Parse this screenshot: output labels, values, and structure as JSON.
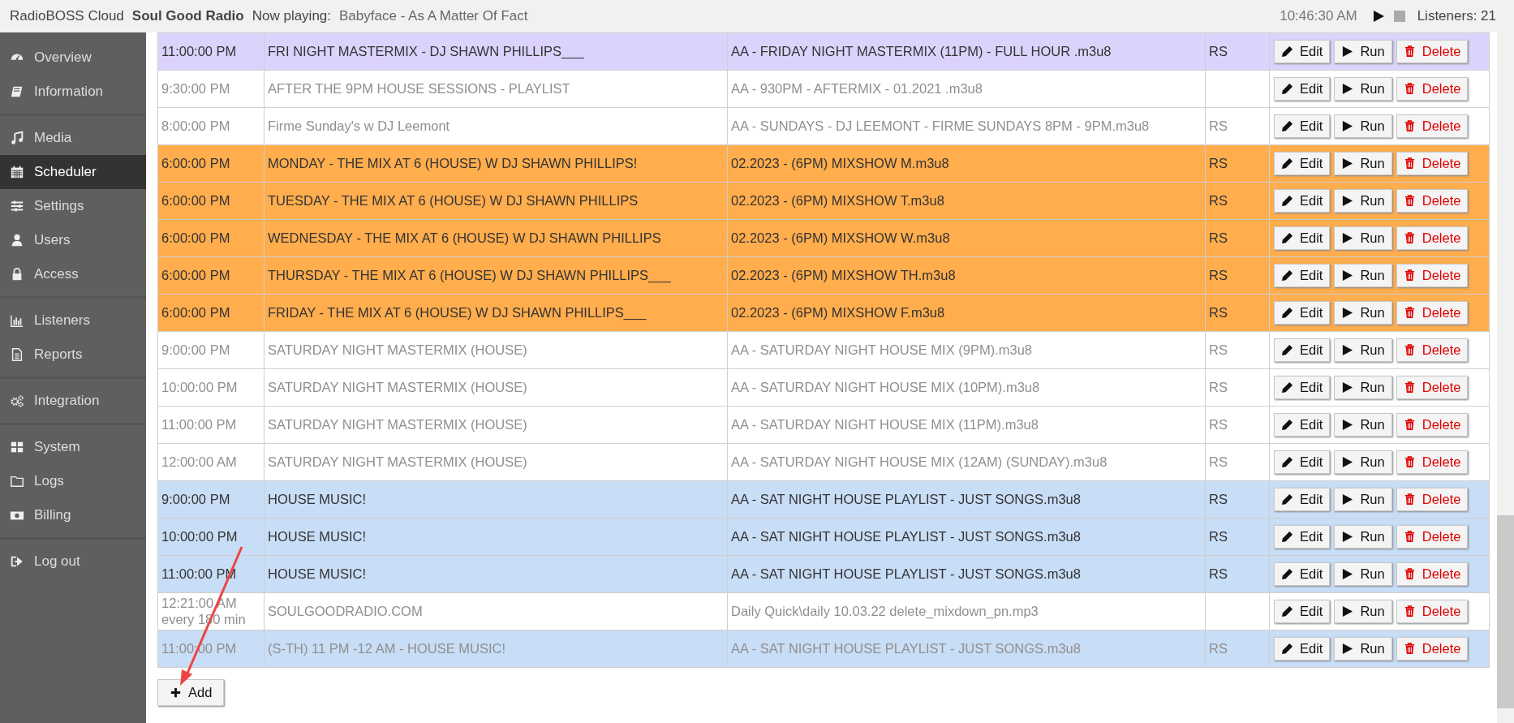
{
  "top_bar": {
    "app_name": "RadioBOSS Cloud",
    "station": "Soul Good Radio",
    "now_playing_label": "Now playing:",
    "now_playing": "Babyface - As A Matter Of Fact",
    "time": "10:46:30 AM",
    "listeners": "Listeners: 21"
  },
  "sidebar": {
    "groups": [
      [
        {
          "label": "Overview",
          "selected": false
        },
        {
          "label": "Information",
          "selected": false
        }
      ],
      [
        {
          "label": "Media",
          "selected": false
        },
        {
          "label": "Scheduler",
          "selected": true
        },
        {
          "label": "Settings",
          "selected": false
        },
        {
          "label": "Users",
          "selected": false
        },
        {
          "label": "Access",
          "selected": false
        }
      ],
      [
        {
          "label": "Listeners",
          "selected": false
        },
        {
          "label": "Reports",
          "selected": false
        }
      ],
      [
        {
          "label": "Integration",
          "selected": false
        }
      ],
      [
        {
          "label": "System",
          "selected": false
        },
        {
          "label": "Logs",
          "selected": false
        },
        {
          "label": "Billing",
          "selected": false
        }
      ],
      [
        {
          "label": "Log out",
          "selected": false
        }
      ]
    ]
  },
  "table": {
    "rows": [
      {
        "time": "11:00:00 PM",
        "name": "FRI NIGHT MASTERMIX - DJ SHAWN PHILLIPS___",
        "file": "AA - FRIDAY NIGHT MASTERMIX (11PM) - FULL HOUR .m3u8",
        "flag": "RS",
        "color": "#dcd3fd",
        "disabled": false,
        "buttons": [
          "Edit",
          "Run",
          "Delete"
        ]
      },
      {
        "time": "9:30:00 PM",
        "name": "AFTER THE 9PM HOUSE SESSIONS - PLAYLIST",
        "file": "AA - 930PM - AFTERMIX - 01.2021 .m3u8",
        "color": "#ffffff",
        "disabled": true,
        "buttons": [
          "Edit",
          "Run",
          "Delete"
        ]
      },
      {
        "time": "8:00:00 PM",
        "name": "Firme Sunday's w DJ Leemont",
        "file": "AA - SUNDAYS - DJ LEEMONT - FIRME SUNDAYS 8PM - 9PM.m3u8",
        "flag": "RS",
        "color": "#ffffff",
        "disabled": true,
        "buttons": [
          "Edit",
          "Run",
          "Delete"
        ]
      },
      {
        "time": "6:00:00 PM",
        "name": "MONDAY - THE MIX AT 6 (HOUSE) W DJ SHAWN PHILLIPS!",
        "file": "02.2023 - (6PM) MIXSHOW M.m3u8",
        "flag": "RS",
        "color": "#ffad4d",
        "disabled": false,
        "buttons": [
          "Edit",
          "Run",
          "Delete"
        ]
      },
      {
        "time": "6:00:00 PM",
        "name": "TUESDAY - THE MIX AT 6 (HOUSE) W DJ SHAWN PHILLIPS",
        "file": "02.2023 - (6PM) MIXSHOW T.m3u8",
        "flag": "RS",
        "color": "#ffad4d",
        "disabled": false,
        "buttons": [
          "Edit",
          "Run",
          "Delete"
        ]
      },
      {
        "time": "6:00:00 PM",
        "name": "WEDNESDAY - THE MIX AT 6 (HOUSE) W DJ SHAWN PHILLIPS",
        "file": "02.2023 - (6PM) MIXSHOW W.m3u8",
        "flag": "RS",
        "color": "#ffad4d",
        "disabled": false,
        "buttons": [
          "Edit",
          "Run",
          "Delete"
        ]
      },
      {
        "time": "6:00:00 PM",
        "name": "THURSDAY - THE MIX AT 6 (HOUSE) W DJ SHAWN PHILLIPS___",
        "file": "02.2023 - (6PM) MIXSHOW TH.m3u8",
        "flag": "RS",
        "color": "#ffad4d",
        "disabled": false,
        "buttons": [
          "Edit",
          "Run",
          "Delete"
        ]
      },
      {
        "time": "6:00:00 PM",
        "name": "FRIDAY - THE MIX AT 6 (HOUSE) W DJ SHAWN PHILLIPS___",
        "file": "02.2023 - (6PM) MIXSHOW F.m3u8",
        "flag": "RS",
        "color": "#ffad4d",
        "disabled": false,
        "buttons": [
          "Edit",
          "Run",
          "Delete"
        ]
      },
      {
        "time": "9:00:00 PM",
        "name": "SATURDAY NIGHT MASTERMIX (HOUSE)",
        "file": "AA - SATURDAY NIGHT HOUSE MIX (9PM).m3u8",
        "flag": "RS",
        "color": "#ffffff",
        "disabled": true,
        "buttons": [
          "Edit",
          "Run",
          "Delete"
        ]
      },
      {
        "time": "10:00:00 PM",
        "name": "SATURDAY NIGHT MASTERMIX (HOUSE)",
        "file": "AA - SATURDAY NIGHT HOUSE MIX (10PM).m3u8",
        "flag": "RS",
        "color": "#ffffff",
        "disabled": true,
        "buttons": [
          "Edit",
          "Run",
          "Delete"
        ]
      },
      {
        "time": "11:00:00 PM",
        "name": "SATURDAY NIGHT MASTERMIX (HOUSE)",
        "file": "AA - SATURDAY NIGHT HOUSE MIX (11PM).m3u8",
        "flag": "RS",
        "color": "#ffffff",
        "disabled": true,
        "buttons": [
          "Edit",
          "Run",
          "Delete"
        ]
      },
      {
        "time": "12:00:00 AM",
        "name": "SATURDAY NIGHT MASTERMIX (HOUSE)",
        "file": "AA - SATURDAY NIGHT HOUSE MIX (12AM) (SUNDAY).m3u8",
        "flag": "RS",
        "color": "#ffffff",
        "disabled": true,
        "buttons": [
          "Edit",
          "Run",
          "Delete"
        ]
      },
      {
        "time": "9:00:00 PM",
        "name": "HOUSE MUSIC!",
        "file": "AA - SAT NIGHT HOUSE PLAYLIST - JUST SONGS.m3u8",
        "flag": "RS",
        "color": "#c8ddf6",
        "disabled": false,
        "buttons": [
          "Edit",
          "Run",
          "Delete"
        ]
      },
      {
        "time": "10:00:00 PM",
        "name": "HOUSE MUSIC!",
        "file": "AA - SAT NIGHT HOUSE PLAYLIST - JUST SONGS.m3u8",
        "flag": "RS",
        "color": "#c8ddf6",
        "disabled": false,
        "buttons": [
          "Edit",
          "Run",
          "Delete"
        ]
      },
      {
        "time": "11:00:00 PM",
        "name": "HOUSE MUSIC!",
        "file": "AA - SAT NIGHT HOUSE PLAYLIST - JUST SONGS.m3u8",
        "flag": "RS",
        "color": "#c8ddf6",
        "disabled": false,
        "buttons": [
          "Edit",
          "Run",
          "Delete"
        ]
      },
      {
        "time": "12:21:00 AM",
        "repeat": "every 180 min",
        "name": "SOULGOODRADIO.COM",
        "file": "Daily Quick\\daily 10.03.22 delete_mixdown_pn.mp3",
        "color": "#ffffff",
        "disabled": true,
        "buttons": [
          "Edit",
          "Run",
          "Delete"
        ]
      },
      {
        "time": "11:00:00 PM",
        "name": "(S-TH) 11 PM -12 AM - HOUSE MUSIC!",
        "file": "AA - SAT NIGHT HOUSE PLAYLIST - JUST SONGS.m3u8",
        "flag": "RS",
        "color": "#c8ddf6",
        "disabled": true,
        "buttons": [
          "Edit",
          "Run",
          "Delete"
        ]
      }
    ]
  },
  "add_button": "Add"
}
